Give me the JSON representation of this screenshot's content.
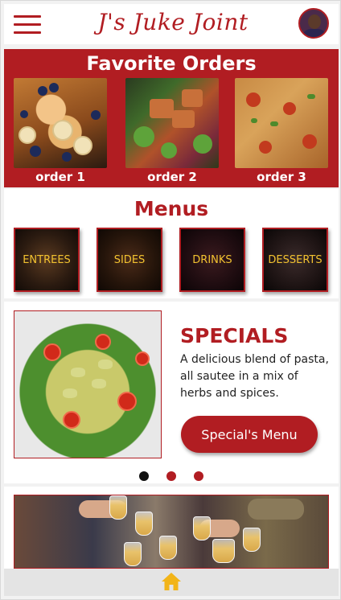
{
  "header": {
    "brand": "J's Juke Joint",
    "menu_icon": "hamburger-menu-icon",
    "avatar_icon": "user-avatar"
  },
  "favorites": {
    "title": "Favorite Orders",
    "orders": [
      {
        "label": "order 1",
        "image": "blueberry-banana-french-toast"
      },
      {
        "label": "order 2",
        "image": "salmon-salad-bowl"
      },
      {
        "label": "order 3",
        "image": "pizza"
      }
    ]
  },
  "menus": {
    "title": "Menus",
    "items": [
      {
        "label": "ENTREES"
      },
      {
        "label": "SIDES"
      },
      {
        "label": "DRINKS"
      },
      {
        "label": "DESSERTS"
      }
    ]
  },
  "specials": {
    "title": "SPECIALS",
    "description": "A delicious blend of pasta, all sautee in a mix of herbs and spices.",
    "button_label": "Special's Menu",
    "image": "farfalle-pasta-salad",
    "carousel": {
      "pages": 3,
      "active": 1
    }
  },
  "bottom_banner": {
    "image": "friends-toasting-drinks"
  },
  "tabbar": {
    "home_icon": "home-icon"
  },
  "colors": {
    "brand_red": "#b11d22",
    "menu_label_yellow": "#f2c230",
    "tabbar_bg": "#e4e4e4",
    "home_icon": "#f2b418"
  }
}
